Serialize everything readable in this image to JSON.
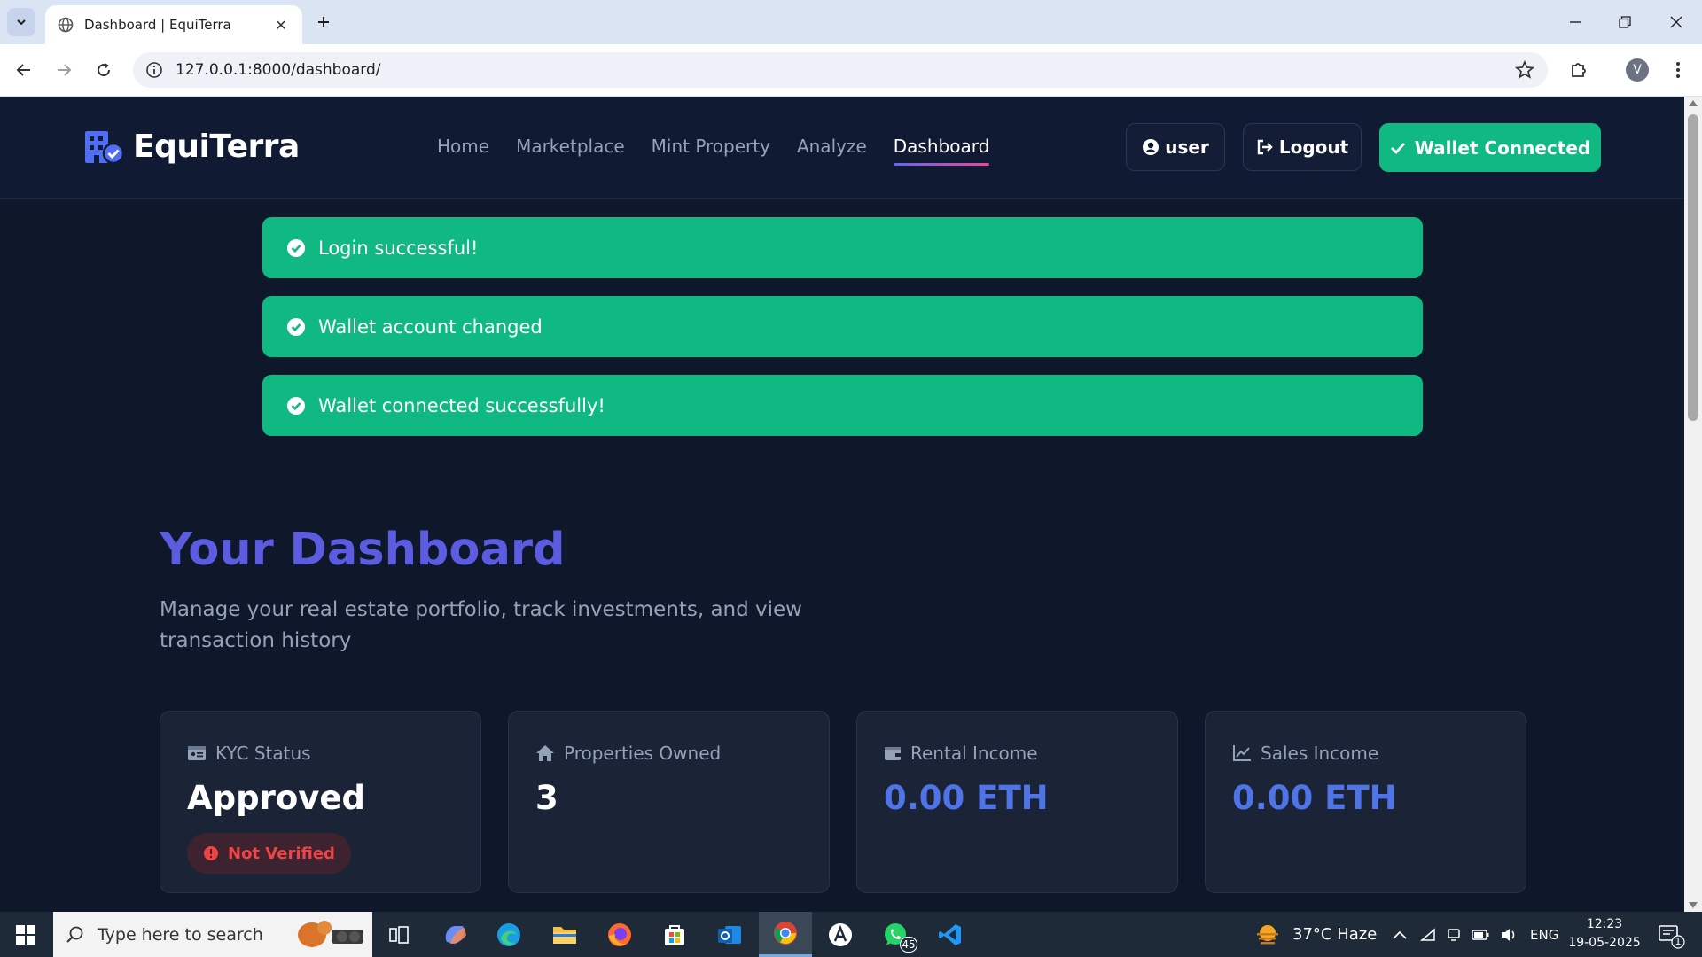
{
  "browser": {
    "tab_title": "Dashboard | EquiTerra",
    "url": "127.0.0.1:8000/dashboard/",
    "profile_initial": "V"
  },
  "site": {
    "brand": "EquiTerra",
    "nav": [
      "Home",
      "Marketplace",
      "Mint Property",
      "Analyze",
      "Dashboard"
    ],
    "active_nav": "Dashboard",
    "user_label": "user",
    "logout_label": "Logout",
    "wallet_label": "Wallet Connected",
    "colors": {
      "accent": "#10b981",
      "title": "#5b5ce0",
      "eth": "#4f74e8",
      "danger": "#ef4444",
      "bg": "#0f172a"
    }
  },
  "alerts": [
    "Login successful!",
    "Wallet account changed",
    "Wallet connected successfully!"
  ],
  "dashboard": {
    "title": "Your Dashboard",
    "subtitle": "Manage your real estate portfolio, track investments, and view transaction history",
    "cards": [
      {
        "icon": "id-card-icon",
        "label": "KYC Status",
        "value": "Approved",
        "badge": "Not Verified"
      },
      {
        "icon": "home-icon",
        "label": "Properties Owned",
        "value": "3"
      },
      {
        "icon": "wallet-icon",
        "label": "Rental Income",
        "value": "0.00 ETH"
      },
      {
        "icon": "chart-line-icon",
        "label": "Sales Income",
        "value": "0.00 ETH"
      }
    ]
  },
  "taskbar": {
    "search_placeholder": "Type here to search",
    "weather": "37°C  Haze",
    "language": "ENG",
    "time": "12:23",
    "date": "19-05-2025",
    "whatsapp_badge": "45",
    "notification_count": "1"
  }
}
